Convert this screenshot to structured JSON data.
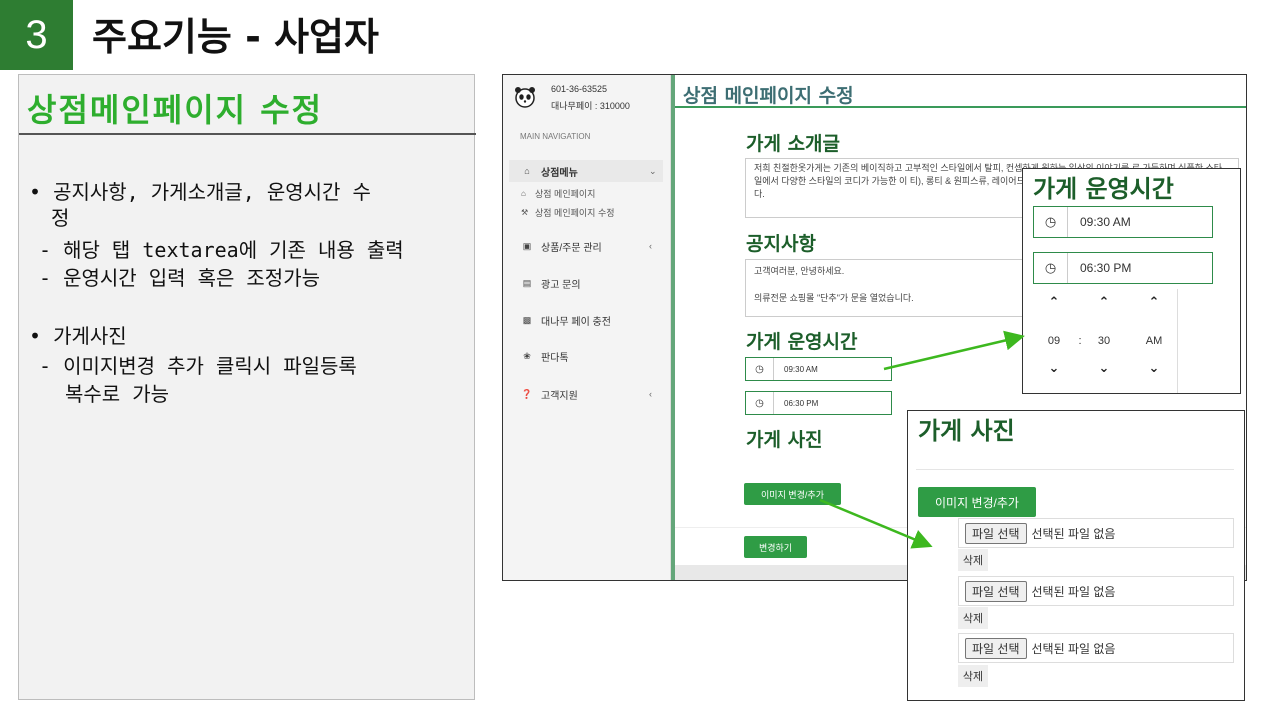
{
  "slide": {
    "number": "3",
    "title": "주요기능 - 사업자"
  },
  "left_panel": {
    "title": "상점메인페이지 수정",
    "bullet1_line1": "• 공지사항, 가게소개글, 운영시간 수",
    "bullet1_line2": "정",
    "bullet1_sub1": "- 해당 탭 textarea에 기존 내용 출력",
    "bullet1_sub2": "- 운영시간 입력 혹은 조정가능",
    "bullet2_line1": "• 가게사진",
    "bullet2_sub1": "- 이미지변경 추가 클릭시 파일등록",
    "bullet2_sub2": "복수로 가능"
  },
  "screenshot": {
    "phone": "601-36-63525",
    "pay": "대나무페이 : 310000",
    "nav_header": "MAIN NAVIGATION",
    "menu": {
      "shop": "상점메뉴",
      "shop_sub1": "상점 메인페이지",
      "shop_sub2": "상점 메인페이지 수정",
      "orders": "상품/주문 관리",
      "ads": "광고 문의",
      "charge": "대나무 페이 충전",
      "panda": "판다톡",
      "support": "고객지원"
    },
    "page_title": "상점 메인페이지 수정",
    "intro_title": "가게 소개글",
    "intro_text": "저희 친절한옷가게는 기존의 베이직하고 고부적인 스타일에서 탈피, 컨셉하게 원하는 일상의 이야기를 로 가득하며 심플한 스타일에서 다양한 스타일의 코디가 가능한 이 티), 롱티 & 원피스류, 레이어드룩, 하의(바지, 랩스커트) 아 판매하고 있는 쇼핑몰입니다.",
    "notice_title": "공지사항",
    "notice_line1": "고객여러분, 안녕하세요.",
    "notice_line2": "의류전문 쇼핑몰 \"단추\"가 문을 열었습니다.",
    "hours_title": "가게 운영시간",
    "open_time": "09:30 AM",
    "close_time": "06:30 PM",
    "photo_title": "가게 사진",
    "photo_button": "이미지 변경/추가",
    "submit_button": "변경하기"
  },
  "popup_time": {
    "title": "가게 운영시간",
    "open_time": "09:30 AM",
    "close_time": "06:30 PM",
    "picker_hour": "09",
    "picker_sep": ":",
    "picker_min": "30",
    "picker_ampm": "AM"
  },
  "popup_photo": {
    "title": "가게 사진",
    "button": "이미지 변경/추가",
    "file_button": "파일 선택",
    "file_status": "선택된 파일 없음",
    "delete": "삭제"
  },
  "colors": {
    "accent_green": "#2e7d32",
    "title_green": "#2eae2e",
    "button_green": "#2f9c45",
    "arrow_green": "#3db81f"
  }
}
